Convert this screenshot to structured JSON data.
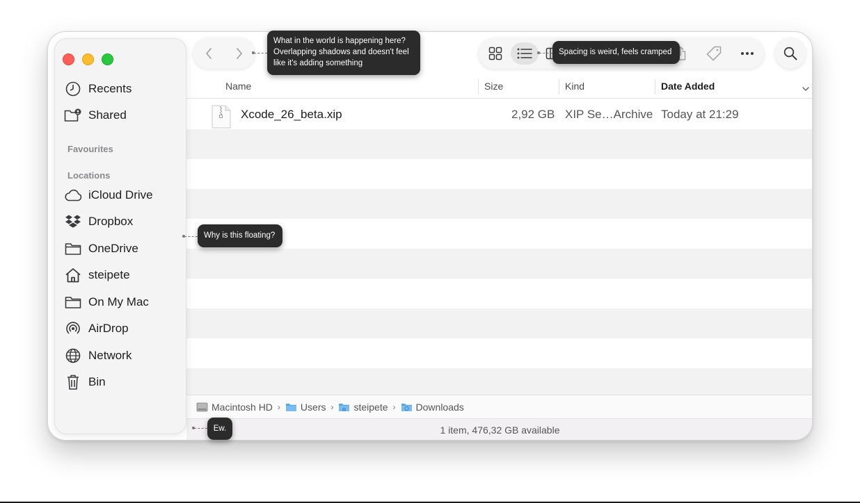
{
  "sidebar": {
    "favourites_heading": "Favourites",
    "locations_heading": "Locations",
    "top_items": [
      {
        "label": "Recents",
        "icon": "clock-icon"
      },
      {
        "label": "Shared",
        "icon": "shared-folder-icon"
      }
    ],
    "locations": [
      {
        "label": "iCloud Drive",
        "icon": "cloud-icon"
      },
      {
        "label": "Dropbox",
        "icon": "dropbox-icon"
      },
      {
        "label": "OneDrive",
        "icon": "folder-icon"
      },
      {
        "label": "steipete",
        "icon": "home-icon"
      },
      {
        "label": "On My Mac",
        "icon": "folder-icon"
      },
      {
        "label": "AirDrop",
        "icon": "airdrop-icon"
      },
      {
        "label": "Network",
        "icon": "globe-icon"
      },
      {
        "label": "Bin",
        "icon": "trash-icon"
      }
    ]
  },
  "columns": {
    "name": "Name",
    "size": "Size",
    "kind": "Kind",
    "date_added": "Date Added"
  },
  "files": [
    {
      "name": "Xcode_26_beta.xip",
      "size": "2,92 GB",
      "kind": "XIP Se…Archive",
      "date_added": "Today at 21:29"
    }
  ],
  "path": {
    "crumbs": [
      "Macintosh HD",
      "Users",
      "steipete",
      "Downloads"
    ],
    "separator": "›"
  },
  "status": "1 item, 476,32 GB available",
  "annotations": {
    "toolbar": "What in the world is happening here? Overlapping shadows and doesn't feel like it's adding something",
    "spacing": "Spacing is weird, feels cramped",
    "floating": "Why is this floating?",
    "ew": "Ew."
  },
  "colors": {
    "close": "#ff5f57",
    "minimize": "#febc2e",
    "zoom": "#28c840",
    "folder_blue": "#5aa9e6"
  }
}
